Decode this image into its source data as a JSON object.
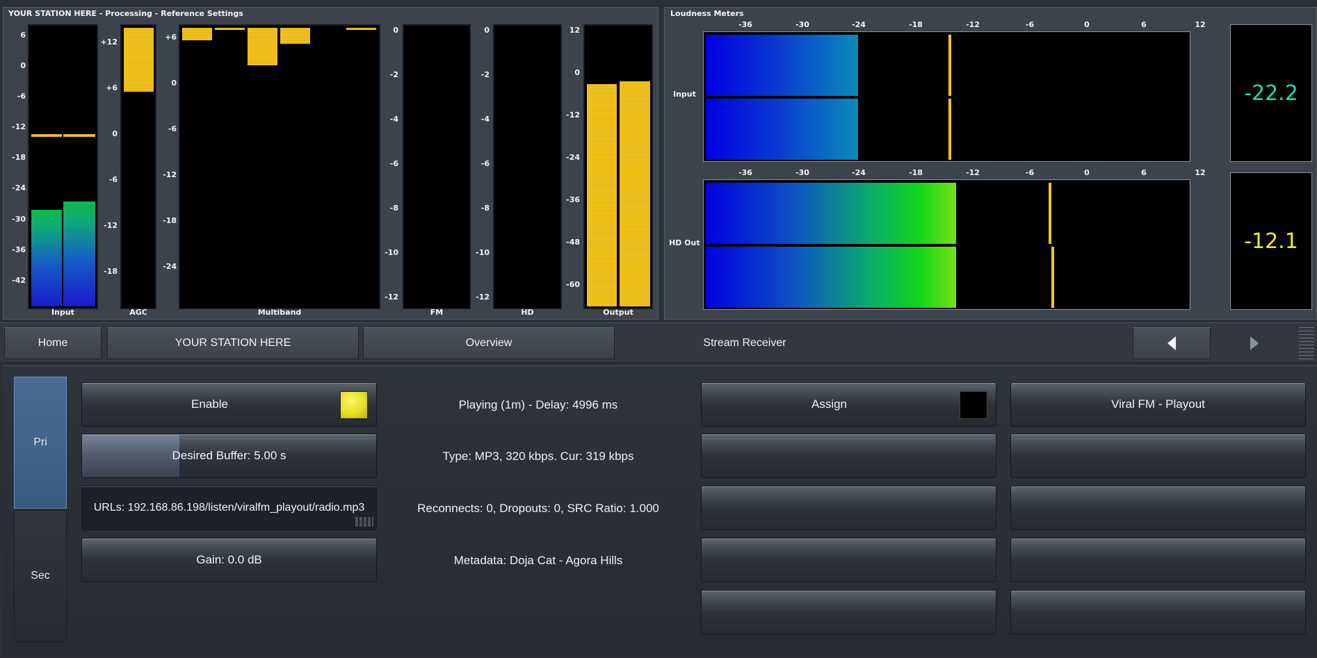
{
  "processing_panel": {
    "title": "YOUR STATION HERE - Processing - Reference Settings",
    "meters": {
      "input": {
        "label": "Input",
        "ticks": [
          "6",
          "0",
          "-6",
          "-12",
          "-18",
          "-24",
          "-30",
          "-36",
          "-42"
        ]
      },
      "agc": {
        "label": "AGC",
        "ticks": [
          "+12",
          "+6",
          "0",
          "-6",
          "-12",
          "-18"
        ]
      },
      "multiband": {
        "label": "Multiband",
        "ticks": [
          "+6",
          "0",
          "-6",
          "-12",
          "-18",
          "-24"
        ]
      },
      "fm": {
        "label": "FM",
        "ticks": [
          "0",
          "-2",
          "-4",
          "-6",
          "-8",
          "-10",
          "-12"
        ]
      },
      "hd": {
        "label": "HD",
        "ticks": [
          "0",
          "-2",
          "-4",
          "-6",
          "-8",
          "-10",
          "-12"
        ]
      },
      "output": {
        "label": "Output",
        "ticks": [
          "12",
          "0",
          "-12",
          "-24",
          "-36",
          "-48",
          "-60"
        ]
      }
    }
  },
  "loudness_panel": {
    "title": "Loudness Meters",
    "scale": [
      "-36",
      "-30",
      "-24",
      "-18",
      "-12",
      "-6",
      "0",
      "6",
      "12"
    ],
    "input": {
      "label": "Input",
      "value": "-22.2",
      "color": "#16e0b0"
    },
    "hd_out": {
      "label": "HD Out",
      "value": "-12.1",
      "color": "#f2f20d"
    }
  },
  "nav": {
    "home": "Home",
    "station": "YOUR STATION HERE",
    "overview": "Overview",
    "stream_receiver": "Stream Receiver"
  },
  "tabs": {
    "pri": "Pri",
    "sec": "Sec"
  },
  "controls": {
    "enable": "Enable",
    "enable_color": "#e8e021",
    "desired_buffer": "Desired Buffer: 5.00 s",
    "urls": "URLs: 192.168.86.198/listen/viralfm_playout/radio.mp3",
    "gain": "Gain: 0.0 dB"
  },
  "status": {
    "playing": "Playing (1m) - Delay: 4996 ms",
    "type": "Type: MP3, 320 kbps. Cur: 319 kbps",
    "reconnects": "Reconnects: 0, Dropouts: 0, SRC Ratio: 1.000",
    "metadata": "Metadata: Doja Cat - Agora Hills"
  },
  "assign": {
    "label": "Assign"
  },
  "source": {
    "label": "Viral FM - Playout"
  }
}
